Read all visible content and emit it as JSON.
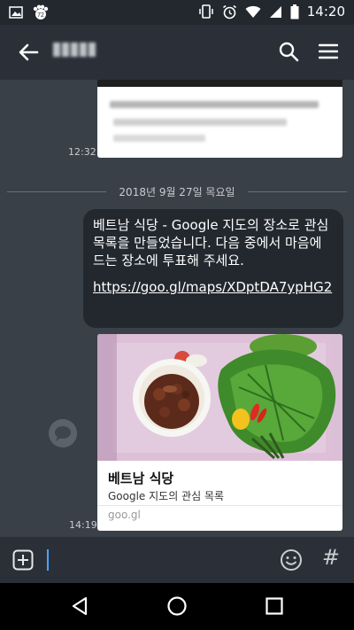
{
  "statusbar": {
    "time": "14:20"
  },
  "chat": {
    "prev_time": "12:32",
    "date_divider": "2018년 9월 27일 목요일",
    "message": {
      "text": "베트남 식당 - Google 지도의 장소로 관심 목록을 만들었습니다. 다음 중에서 마음에 드는 장소에 투표해 주세요.",
      "link": "https://goo.gl/maps/XDptDA7ypHG2"
    },
    "link_card": {
      "title": "베트남 식당",
      "subtitle": "Google 지도의 관심 목록",
      "domain": "goo.gl",
      "time": "14:19"
    }
  },
  "input": {
    "hash_label": "#"
  },
  "colors": {
    "background": "#3a4048",
    "bubble": "#23282f",
    "appbar": "#2b3038",
    "cursor": "#4da3ff"
  }
}
